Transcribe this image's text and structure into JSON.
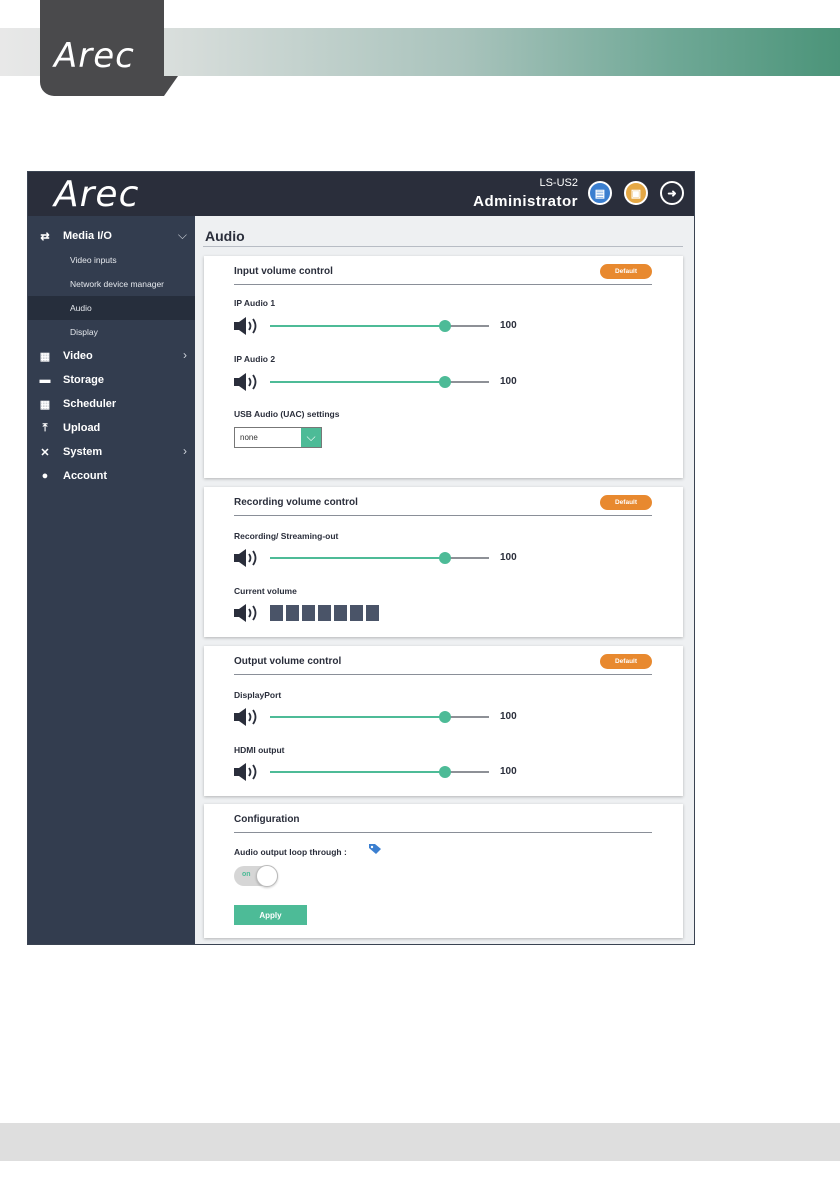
{
  "document": {
    "logo_text": "Arec"
  },
  "app": {
    "logo_text": "Arec",
    "model": "LS-US2",
    "role": "Administrator",
    "icons": [
      "clapperboard-icon",
      "film-icon",
      "logout-icon"
    ]
  },
  "sidebar": {
    "items": [
      {
        "label": "Media I/O",
        "icon": "media-io-icon",
        "expanded": true
      },
      {
        "label": "Video",
        "icon": "film-strip-icon"
      },
      {
        "label": "Storage",
        "icon": "storage-icon"
      },
      {
        "label": "Scheduler",
        "icon": "calendar-icon"
      },
      {
        "label": "Upload",
        "icon": "upload-icon"
      },
      {
        "label": "System",
        "icon": "tools-icon"
      },
      {
        "label": "Account",
        "icon": "user-icon"
      }
    ],
    "subitems": [
      "Video inputs",
      "Network device manager",
      "Audio",
      "Display"
    ],
    "active_subitem": "Audio"
  },
  "main": {
    "page_title": "Audio",
    "default_label": "Default",
    "input": {
      "title": "Input volume control",
      "ip_audio_1": {
        "label": "IP Audio 1",
        "value": "100",
        "level": 0.8
      },
      "ip_audio_2": {
        "label": "IP Audio 2",
        "value": "100",
        "level": 0.8
      },
      "usb_label": "USB Audio (UAC) settings",
      "usb_selected": "none"
    },
    "recording": {
      "title": "Recording volume control",
      "streaming": {
        "label": "Recording/ Streaming-out",
        "value": "100",
        "level": 0.8
      },
      "current_label": "Current volume",
      "current_segments": 7
    },
    "output": {
      "title": "Output volume control",
      "displayport": {
        "label": "DisplayPort",
        "value": "100",
        "level": 0.8
      },
      "hdmi": {
        "label": "HDMI output",
        "value": "100",
        "level": 0.8
      }
    },
    "configuration": {
      "title": "Configuration",
      "loop_label": "Audio output loop through :",
      "toggle_state": "on",
      "apply_label": "Apply"
    }
  },
  "colors": {
    "accent": "#4dbb97",
    "default_button": "#e8892f",
    "sidebar": "#333d4f",
    "topbar": "#2a2e3b"
  }
}
